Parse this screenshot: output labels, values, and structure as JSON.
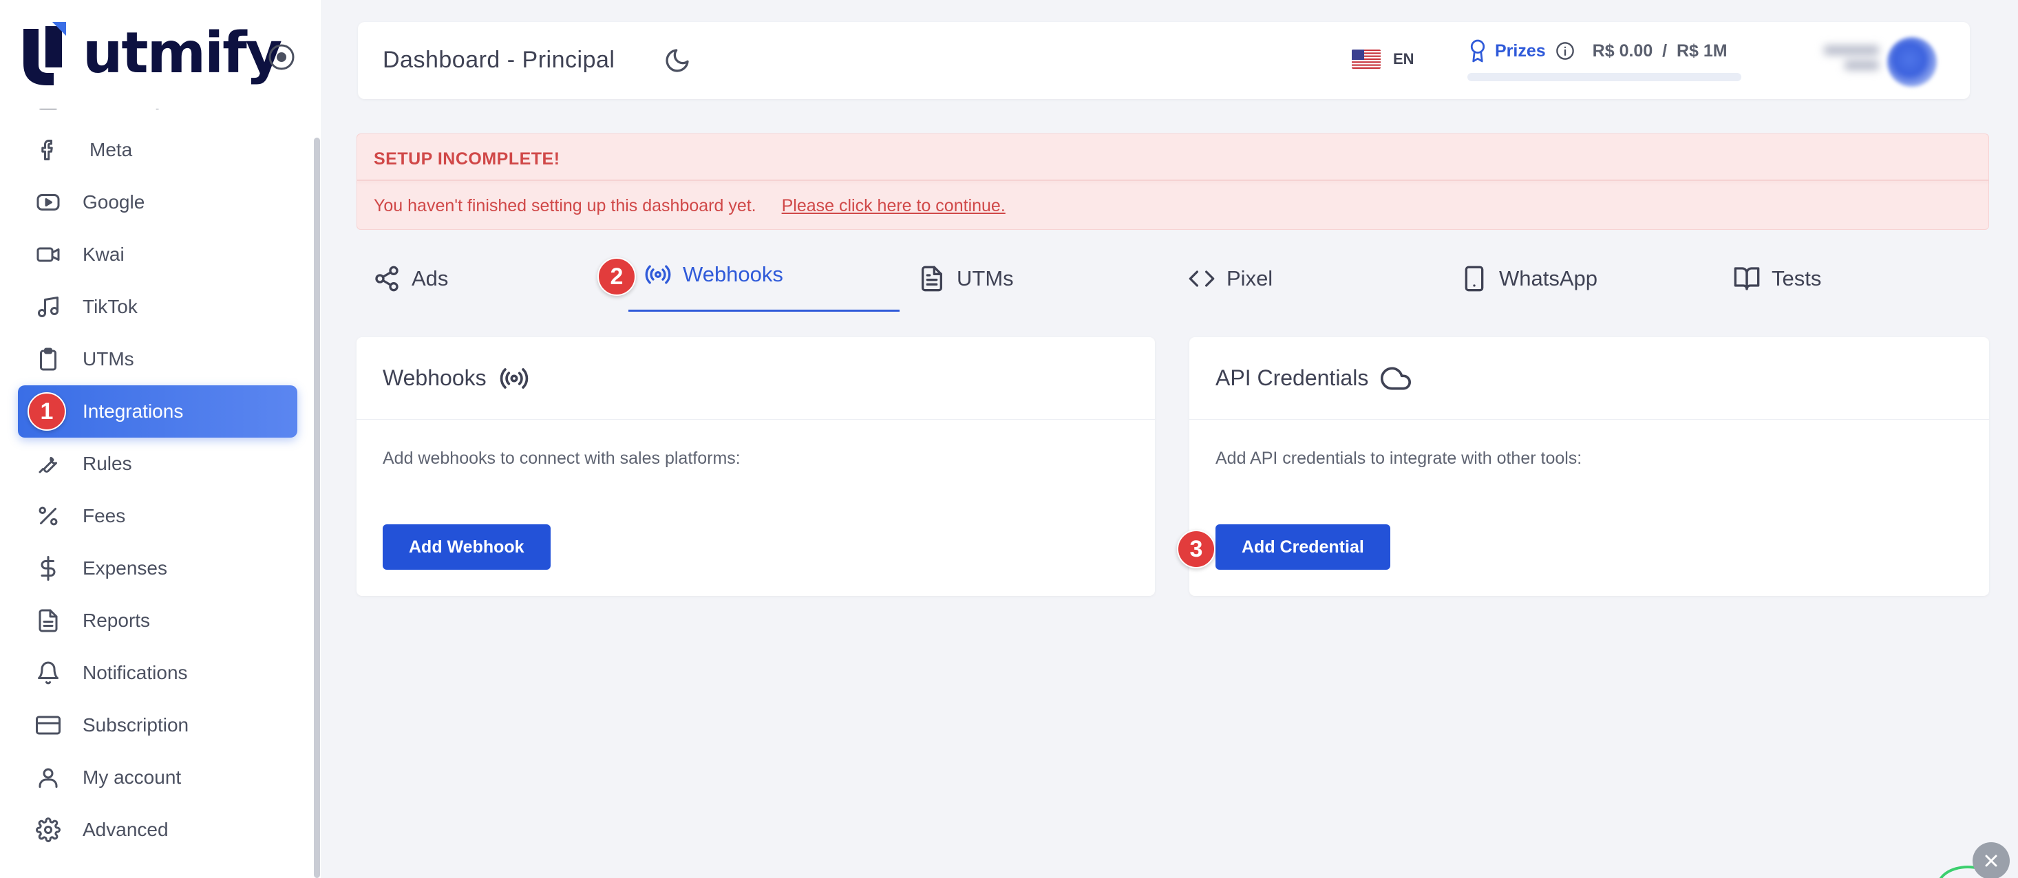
{
  "brand": {
    "name": "utmify"
  },
  "sidebar": {
    "items": [
      {
        "label": "Summary",
        "icon": "summary-icon",
        "key": "summary"
      },
      {
        "label": "Meta",
        "icon": "facebook-icon",
        "key": "meta"
      },
      {
        "label": "Google",
        "icon": "youtube-icon",
        "key": "google"
      },
      {
        "label": "Kwai",
        "icon": "video-camera-icon",
        "key": "kwai"
      },
      {
        "label": "TikTok",
        "icon": "music-note-icon",
        "key": "tiktok"
      },
      {
        "label": "UTMs",
        "icon": "clipboard-icon",
        "key": "utms"
      },
      {
        "label": "Integrations",
        "icon": "link-icon",
        "key": "integrations"
      },
      {
        "label": "Rules",
        "icon": "wrench-icon",
        "key": "rules"
      },
      {
        "label": "Fees",
        "icon": "percent-icon",
        "key": "fees"
      },
      {
        "label": "Expenses",
        "icon": "dollar-icon",
        "key": "expenses"
      },
      {
        "label": "Reports",
        "icon": "document-icon",
        "key": "reports"
      },
      {
        "label": "Notifications",
        "icon": "bell-icon",
        "key": "notifications"
      },
      {
        "label": "Subscription",
        "icon": "credit-card-icon",
        "key": "subscription"
      },
      {
        "label": "My account",
        "icon": "user-icon",
        "key": "my-account"
      },
      {
        "label": "Advanced",
        "icon": "gear-icon",
        "key": "advanced"
      }
    ],
    "active": "Integrations"
  },
  "header": {
    "title": "Dashboard - Principal",
    "language": "EN",
    "prizes_label": "Prizes",
    "prizes_amount": "R$ 0.00  /  R$ 1M",
    "prizes_progress": 0
  },
  "alert": {
    "title": "SETUP INCOMPLETE!",
    "message": "You haven't finished setting up this dashboard yet.",
    "link": "Please click here to continue."
  },
  "tabs": [
    {
      "label": "Ads",
      "icon": "share-icon"
    },
    {
      "label": "Webhooks",
      "icon": "broadcast-icon"
    },
    {
      "label": "UTMs",
      "icon": "file-text-icon"
    },
    {
      "label": "Pixel",
      "icon": "code-icon"
    },
    {
      "label": "WhatsApp",
      "icon": "smartphone-icon"
    },
    {
      "label": "Tests",
      "icon": "book-open-icon"
    }
  ],
  "active_tab": "Webhooks",
  "cards": {
    "webhooks": {
      "title": "Webhooks",
      "description": "Add webhooks to connect with sales platforms:",
      "button": "Add Webhook"
    },
    "credentials": {
      "title": "API Credentials",
      "description": "Add API credentials to integrate with other tools:",
      "button": "Add Credential"
    }
  },
  "steps": [
    "1",
    "2",
    "3"
  ],
  "colors": {
    "accent": "#2352d8",
    "alert_bg": "#fce8e8",
    "alert_text": "#d04848",
    "step_badge": "#e23c3c"
  }
}
